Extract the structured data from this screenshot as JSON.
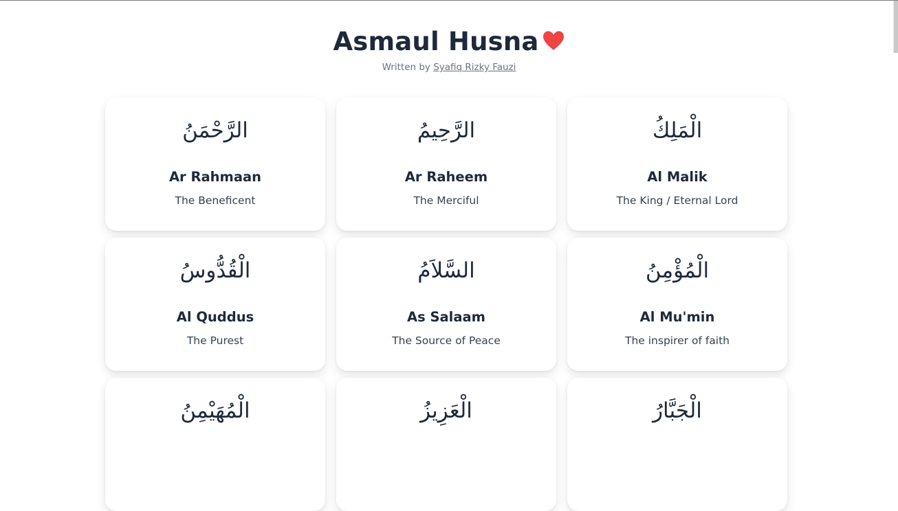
{
  "header": {
    "title": "Asmaul Husna",
    "heart_icon": "heart-icon",
    "heart_color": "#ef4444",
    "byline_prefix": "Written by",
    "author_name": "Syafiq Rizky Fauzi"
  },
  "names": [
    {
      "arabic": "الرَّحْمَنُ",
      "latin": "Ar Rahmaan",
      "meaning": "The Beneficent"
    },
    {
      "arabic": "الرَّحِيمُ",
      "latin": "Ar Raheem",
      "meaning": "The Merciful"
    },
    {
      "arabic": "الْمَلِكُ",
      "latin": "Al Malik",
      "meaning": "The King / Eternal Lord"
    },
    {
      "arabic": "الْقُدُّوسُ",
      "latin": "Al Quddus",
      "meaning": "The Purest"
    },
    {
      "arabic": "السَّلاَمُ",
      "latin": "As Salaam",
      "meaning": "The Source of Peace"
    },
    {
      "arabic": "الْمُؤْمِنُ",
      "latin": "Al Mu'min",
      "meaning": "The inspirer of faith"
    },
    {
      "arabic": "الْمُهَيْمِنُ",
      "latin": "",
      "meaning": ""
    },
    {
      "arabic": "الْعَزِيزُ",
      "latin": "",
      "meaning": ""
    },
    {
      "arabic": "الْجَبَّارُ",
      "latin": "",
      "meaning": ""
    }
  ]
}
